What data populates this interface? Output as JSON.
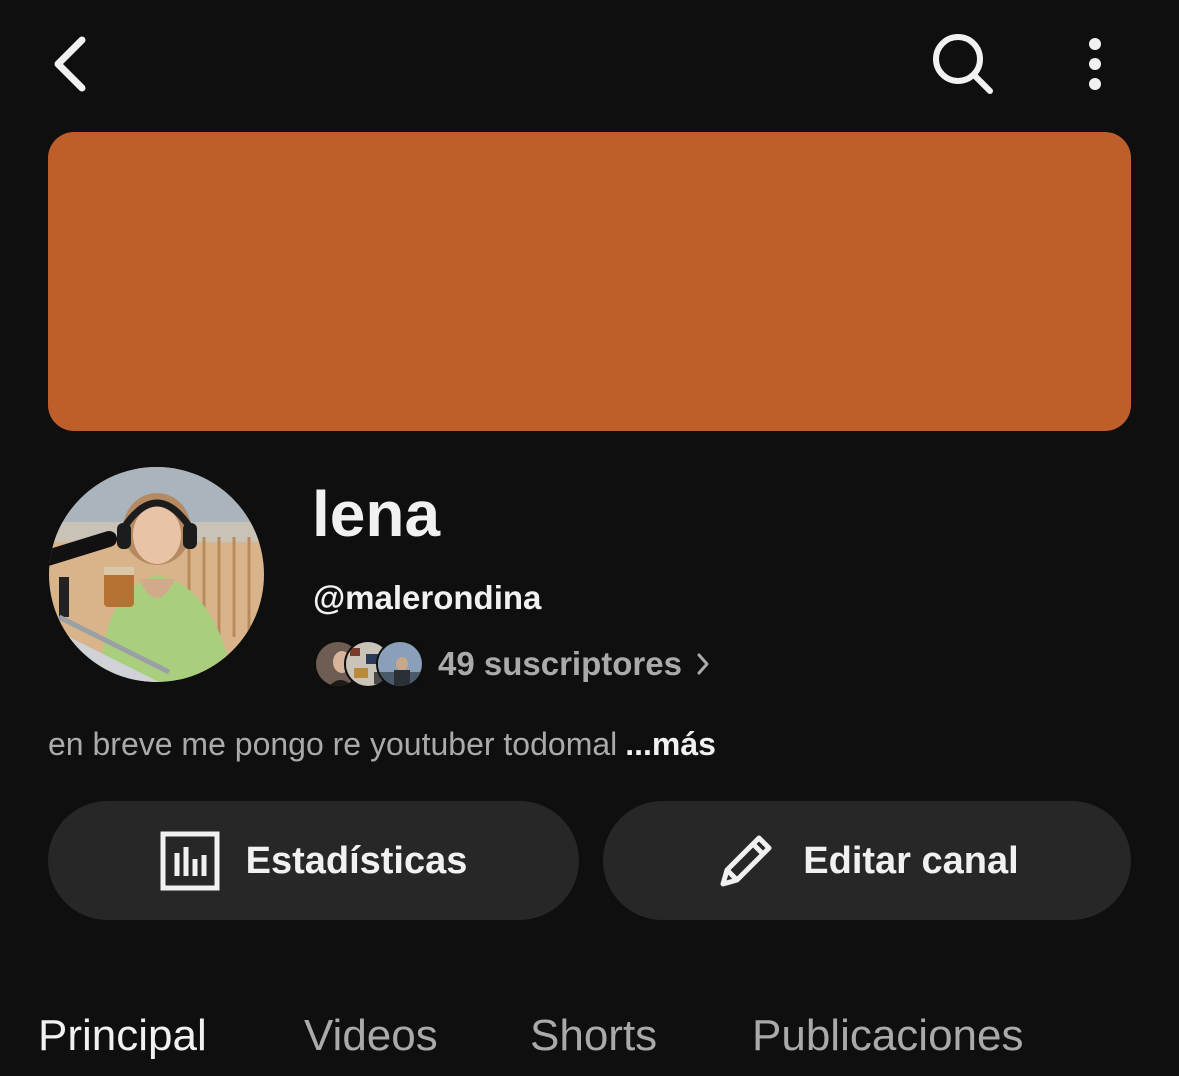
{
  "header": {
    "back_icon": "chevron-left-icon",
    "search_icon": "search-icon",
    "more_icon": "more-vertical-icon"
  },
  "banner": {
    "color": "#bd5e2b"
  },
  "channel": {
    "name": "lena",
    "handle": "@malerondina",
    "subscribers": "49 suscriptores",
    "description": "en breve me pongo re youtuber todomal",
    "more_label": "...más"
  },
  "actions": {
    "stats_label": "Estadísticas",
    "edit_label": "Editar canal"
  },
  "tabs": [
    {
      "label": "Principal",
      "active": true
    },
    {
      "label": "Videos",
      "active": false
    },
    {
      "label": "Shorts",
      "active": false
    },
    {
      "label": "Publicaciones",
      "active": false
    }
  ],
  "colors": {
    "background": "#0f0f0f",
    "pill": "#272727",
    "text_primary": "#f1f1f1",
    "text_secondary": "#aaaaaa"
  }
}
